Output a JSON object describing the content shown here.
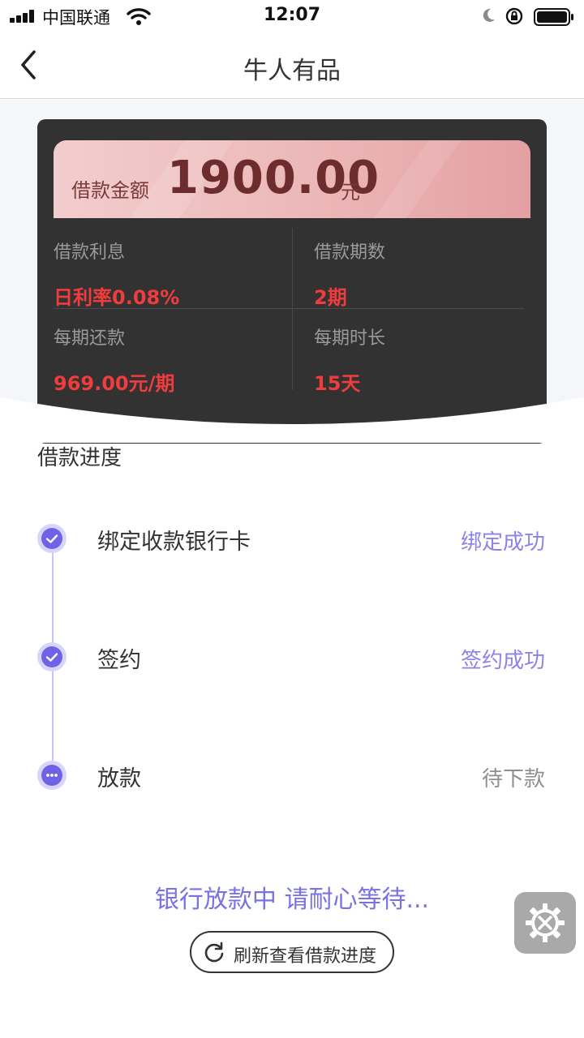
{
  "status_bar": {
    "carrier": "中国联通",
    "time": "12:07"
  },
  "nav": {
    "title": "牛人有品"
  },
  "loan_card": {
    "amount_label": "借款金额",
    "amount_value": "1900.00",
    "amount_unit": "元",
    "details": [
      {
        "label": "借款利息",
        "value": "日利率0.08%"
      },
      {
        "label": "借款期数",
        "value": "2期"
      },
      {
        "label": "每期还款",
        "value": "969.00元/期"
      },
      {
        "label": "每期时长",
        "value": "15天"
      }
    ]
  },
  "progress": {
    "title": "借款进度",
    "steps": [
      {
        "name": "绑定收款银行卡",
        "status": "绑定成功",
        "state": "done"
      },
      {
        "name": "签约",
        "status": "签约成功",
        "state": "done"
      },
      {
        "name": "放款",
        "status": "待下款",
        "state": "pending"
      }
    ]
  },
  "waiting_message": "银行放款中 请耐心等待...",
  "refresh_button": {
    "label": "刷新查看借款进度",
    "icon": "refresh-icon"
  },
  "floating_tool": {
    "icon": "gear-wrench-icon"
  },
  "colors": {
    "accent": "#6e63e6",
    "accent_text": "#8c82ea",
    "value_red": "#f03c3c",
    "card_bg": "#323232",
    "banner": "#ecb7b8"
  }
}
